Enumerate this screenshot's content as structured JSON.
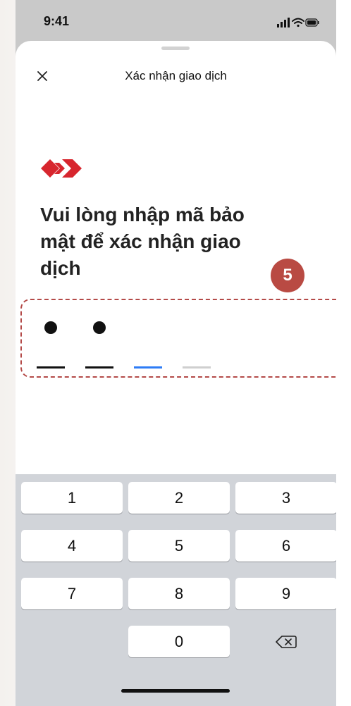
{
  "status_bar": {
    "time": "9:41"
  },
  "sheet": {
    "title": "Xác nhận giao dịch"
  },
  "headline": "Vui lòng nhập mã bảo mật để xác nhận giao dịch",
  "step_badge": "5",
  "pin": {
    "digits_entered": 2,
    "length": 4,
    "colors": {
      "filled": "#111111",
      "active": "#2e7cf6",
      "empty": "#cfcfcf"
    }
  },
  "keypad": {
    "rows": [
      [
        "1",
        "2",
        "3"
      ],
      [
        "4",
        "5",
        "6"
      ],
      [
        "7",
        "8",
        "9"
      ],
      [
        "",
        "0",
        "backspace-icon"
      ]
    ]
  },
  "colors": {
    "brand_red": "#d7262e",
    "badge_red": "#b94a43",
    "dashed_border": "#b44a48"
  }
}
